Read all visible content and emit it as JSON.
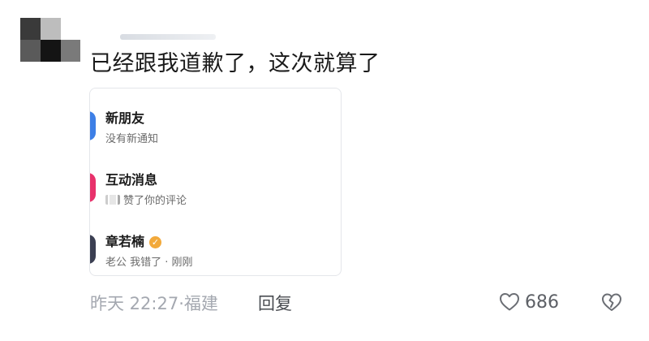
{
  "comment": {
    "text": "已经跟我道歉了，这次就算了",
    "time_location": "昨天 22:27·福建",
    "reply_label": "回复",
    "like_count": "686"
  },
  "card": {
    "items": [
      {
        "title": "新朋友",
        "subtitle": "没有新通知",
        "accent_color": "#3d7fe6"
      },
      {
        "title": "互动消息",
        "subtitle": "赞了你的评论",
        "accent_color": "#e8316b"
      },
      {
        "title": "章若楠",
        "subtitle": "老公 我错了 · 刚刚",
        "accent_color": "#3b3f52",
        "verified": true
      }
    ]
  },
  "icons": {
    "like": "heart-outline-icon",
    "dislike": "broken-heart-icon",
    "verified": "verified-badge-icon"
  }
}
